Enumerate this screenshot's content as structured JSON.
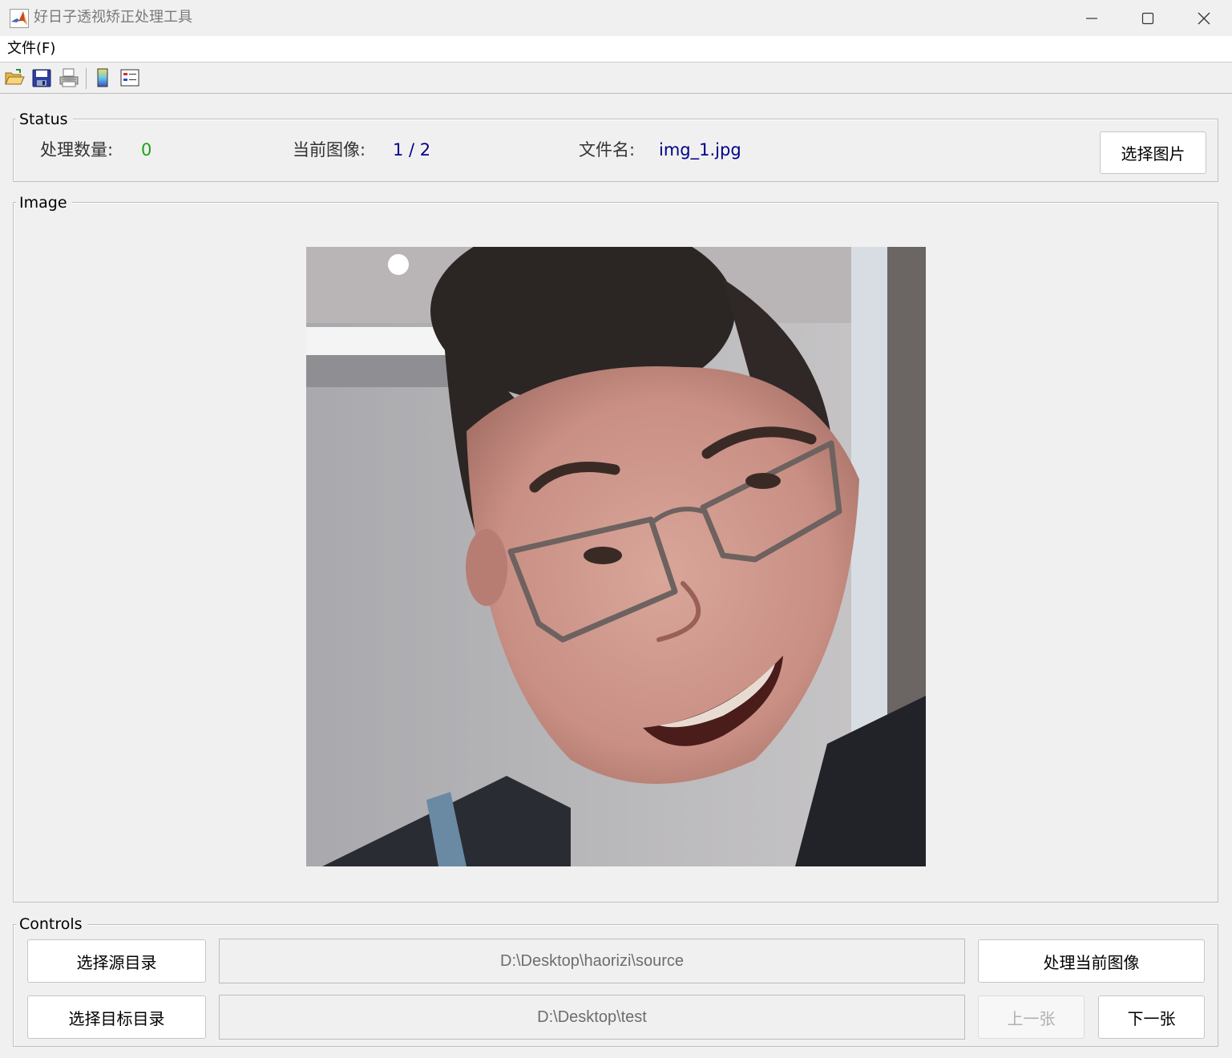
{
  "window": {
    "title": "好日子透视矫正处理工具",
    "icon": "matlab-icon"
  },
  "menu": {
    "file": "文件(F)"
  },
  "toolbar": {
    "icons": [
      "open-folder-icon",
      "save-icon",
      "print-icon",
      "colorbar-icon",
      "legend-icon"
    ]
  },
  "status": {
    "panel_title": "Status",
    "processed_label": "处理数量:",
    "processed_value": "0",
    "current_label": "当前图像:",
    "current_value": "1 / 2",
    "filename_label": "文件名:",
    "filename_value": "img_1.jpg",
    "select_image_button": "选择图片"
  },
  "image_panel": {
    "title": "Image"
  },
  "controls": {
    "panel_title": "Controls",
    "select_source_button": "选择源目录",
    "source_path": "D:\\Desktop\\haorizi\\source",
    "process_button": "处理当前图像",
    "select_target_button": "选择目标目录",
    "target_path": "D:\\Desktop\\test",
    "prev_button": "上一张",
    "next_button": "下一张"
  },
  "colors": {
    "processed_value": "#1aa31a",
    "info_value": "#00008b",
    "window_bg": "#f0f0f0"
  }
}
